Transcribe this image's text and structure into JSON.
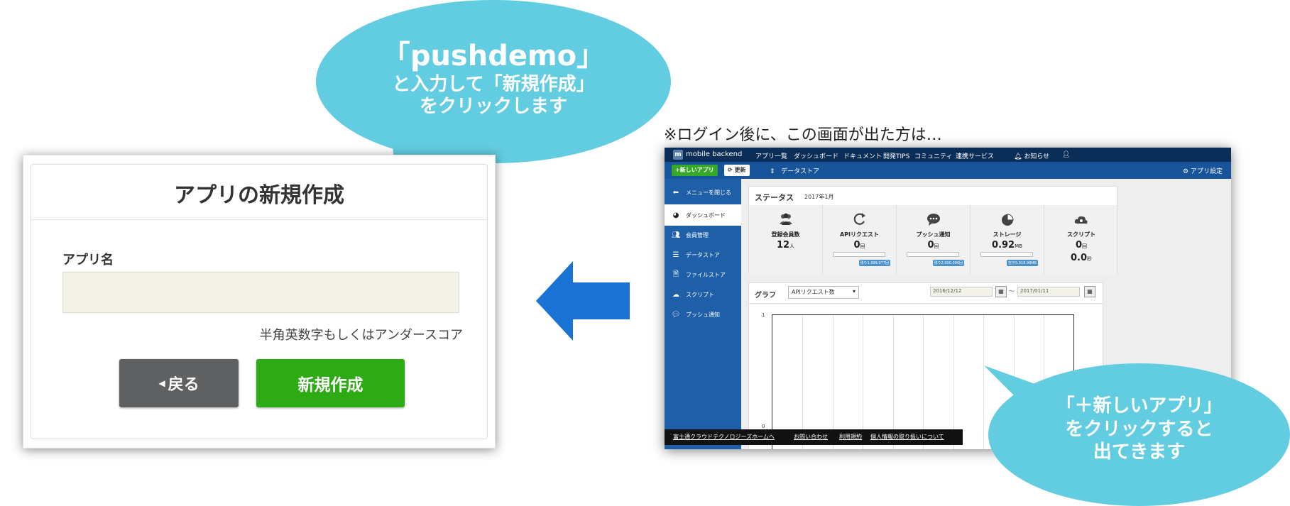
{
  "dialog": {
    "title": "アプリの新規作成",
    "app_name_label": "アプリ名",
    "app_name_value": "",
    "app_name_placeholder": "",
    "app_name_hint": "半角英数字もしくはアンダースコア",
    "back_button": "戻る",
    "create_button": "新規作成"
  },
  "callouts": {
    "top_line1": "「pushdemo」",
    "top_line2": "と入力して「新規作成」",
    "top_line3": "をクリックします",
    "bottom_line1": "「＋新しいアプリ」",
    "bottom_line2": "をクリックすると",
    "bottom_line3": "出てきます",
    "bubble_color": "#62cde0"
  },
  "arrow": {
    "direction": "left",
    "color": "#1a73d4",
    "icon": "arrow-left-icon"
  },
  "note": "※ログイン後に、この画面が出た方は…",
  "dashboard": {
    "logo_text": "mobile backend",
    "nav": [
      "アプリ一覧",
      "ダッシュボード",
      "ドキュメント",
      "開発TIPS",
      "コミュニティ",
      "連携サービス"
    ],
    "notifications": "お知らせ",
    "new_app_button": "+新しいアプリ",
    "refresh_button": "更新",
    "datastore_select": "データストア",
    "app_settings": "アプリ設定",
    "sidebar": [
      {
        "label": "メニューを閉じる",
        "icon": "arrow-left-circle-icon"
      },
      {
        "label": "ダッシュボード",
        "icon": "gauge-icon"
      },
      {
        "label": "会員管理",
        "icon": "users-icon"
      },
      {
        "label": "データストア",
        "icon": "list-icon"
      },
      {
        "label": "ファイルストア",
        "icon": "file-icon"
      },
      {
        "label": "スクリプト",
        "icon": "cloud-gear-icon"
      },
      {
        "label": "プッシュ通知",
        "icon": "chat-icon"
      }
    ],
    "status": {
      "title": "ステータス",
      "month": "2017年1月",
      "stats": [
        {
          "label": "登録会員数",
          "value": "12",
          "unit": "人",
          "badge": "",
          "icon": "users-icon"
        },
        {
          "label": "APIリクエスト",
          "value": "0",
          "unit": "回",
          "badge": "残り1,999,977回",
          "icon": "refresh-icon"
        },
        {
          "label": "プッシュ通知",
          "value": "0",
          "unit": "回",
          "badge": "残り2,000,000回",
          "icon": "chat-icon"
        },
        {
          "label": "ストレージ",
          "value": "0.92",
          "unit": "MB",
          "badge": "空き5,018.98MB",
          "icon": "pie-icon"
        },
        {
          "label": "スクリプト",
          "value": "0",
          "unit": "回",
          "value2": "0.0",
          "unit2": "秒",
          "badge": "",
          "icon": "cloud-gear-icon"
        }
      ]
    },
    "graph": {
      "title": "グラフ",
      "select_value": "APIリクエスト数",
      "date_from": "2016/12/12",
      "date_sep": "～",
      "date_to": "2017/01/11",
      "y_max": "1",
      "y_min": "0"
    },
    "footer_links": [
      "富士通クラウドテクノロジーズホームへ",
      "お問い合わせ",
      "利用規約",
      "個人情報の取り扱いについて"
    ]
  }
}
